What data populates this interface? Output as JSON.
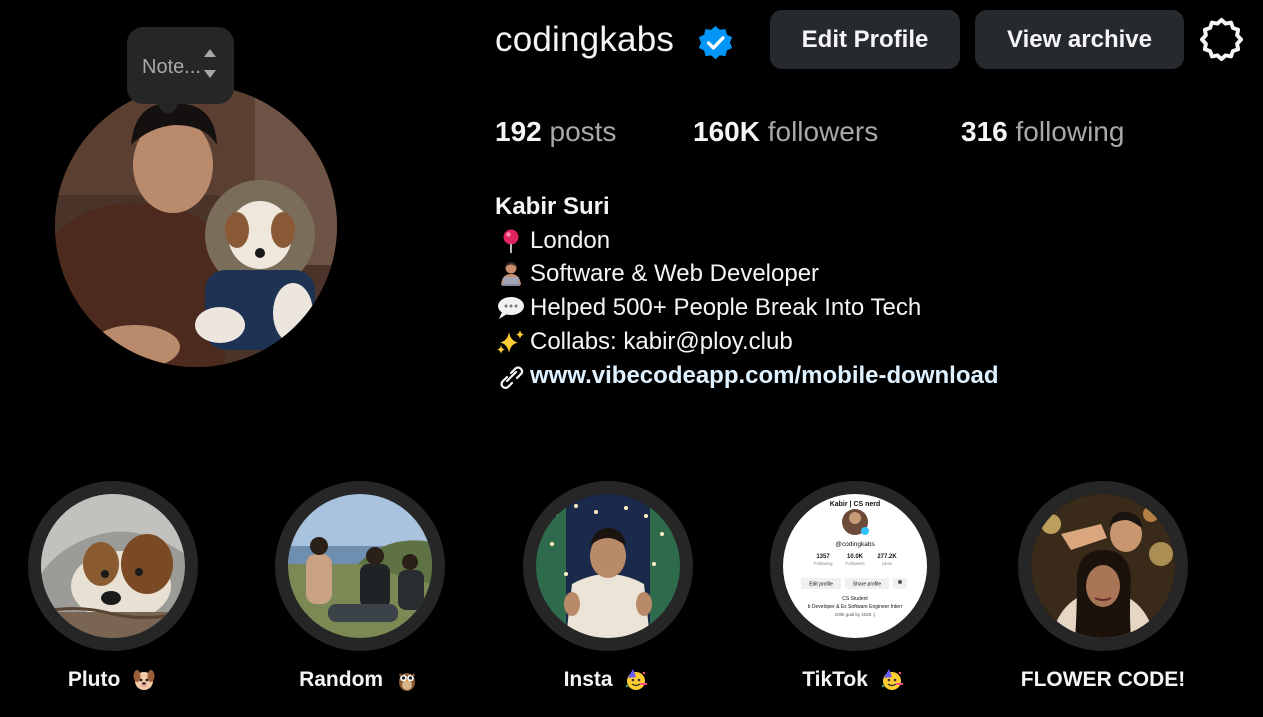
{
  "profile": {
    "username": "codingkabs",
    "note_placeholder": "Note...",
    "buttons": {
      "edit_profile": "Edit Profile",
      "view_archive": "View archive"
    },
    "stats": {
      "posts_count": "192",
      "posts_label": "posts",
      "followers_count": "160K",
      "followers_label": "followers",
      "following_count": "316",
      "following_label": "following"
    },
    "full_name": "Kabir Suri",
    "bio": {
      "location": "London",
      "role": "Software & Web Developer",
      "achievement": "Helped 500+ People Break Into Tech",
      "collab": "Collabs: kabir@ploy.club",
      "link": "www.vibecodeapp.com/mobile-download"
    },
    "icons": {
      "verified": "verified-badge-icon",
      "settings": "gear-icon",
      "location": "pin-icon",
      "role": "technologist-icon",
      "achievement": "speech-bubble-icon",
      "collab": "sparkles-icon",
      "link": "link-icon"
    }
  },
  "highlights": [
    {
      "label": "Pluto",
      "emoji": "dog-face-icon"
    },
    {
      "label": "Random",
      "emoji": "owl-icon"
    },
    {
      "label": "Insta",
      "emoji": "party-face-icon"
    },
    {
      "label": "TikTok",
      "emoji": "party-face-icon"
    },
    {
      "label": "FLOWER CODE!",
      "emoji": ""
    }
  ],
  "tiktok_thumb": {
    "name": "Kabir | CS nerd",
    "handle": "@codingkabs",
    "following": "1357",
    "followers": "10.0K",
    "likes": "277.2K",
    "following_label": "Following",
    "followers_label": "Followers",
    "likes_label": "Likes",
    "edit_btn": "Edit profile",
    "share_btn": "Share profile",
    "bio1": "CS Student",
    "bio2": "b Developer & Ex Software Engineer Interr",
    "bio3": "100k goal by 2025 :)"
  },
  "colors": {
    "background": "#000000",
    "button_bg": "#262a2f",
    "secondary_text": "#a8a8a8",
    "verified_blue": "#0095f6",
    "highlight_ring": "#262626"
  }
}
